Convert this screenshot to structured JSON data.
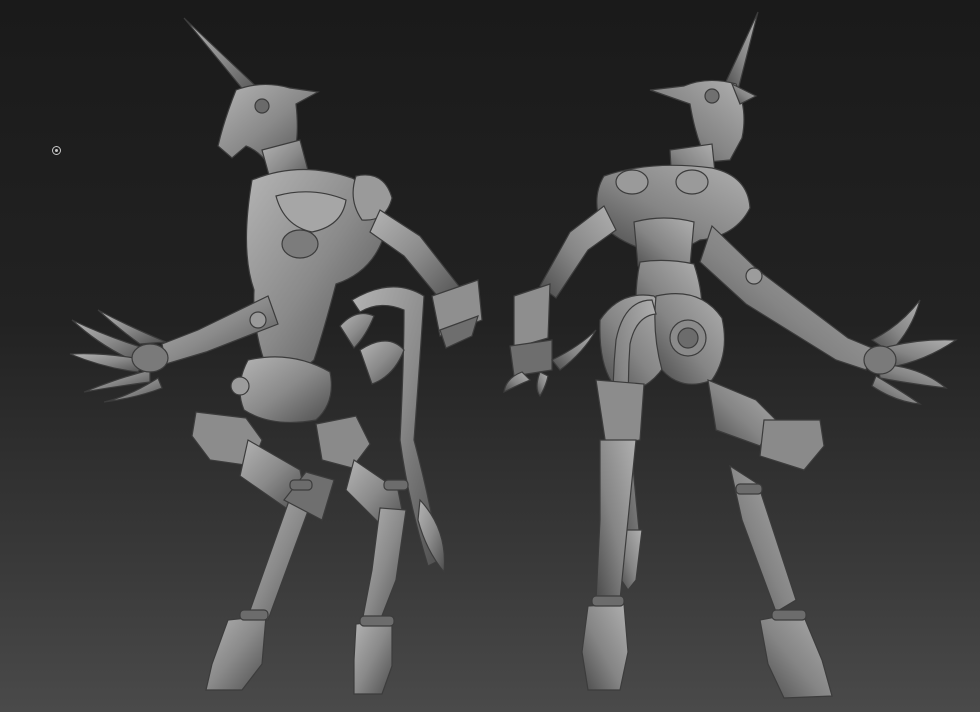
{
  "viewport": {
    "background_top": "#1a1a1a",
    "background_bottom": "#4a4a4a",
    "material_color": "#8e8e8e"
  },
  "cursor": {
    "icon": "brush-cursor-icon"
  },
  "models": [
    {
      "view": "front",
      "name": "sculpt-front-view"
    },
    {
      "view": "back",
      "name": "sculpt-back-view"
    }
  ]
}
